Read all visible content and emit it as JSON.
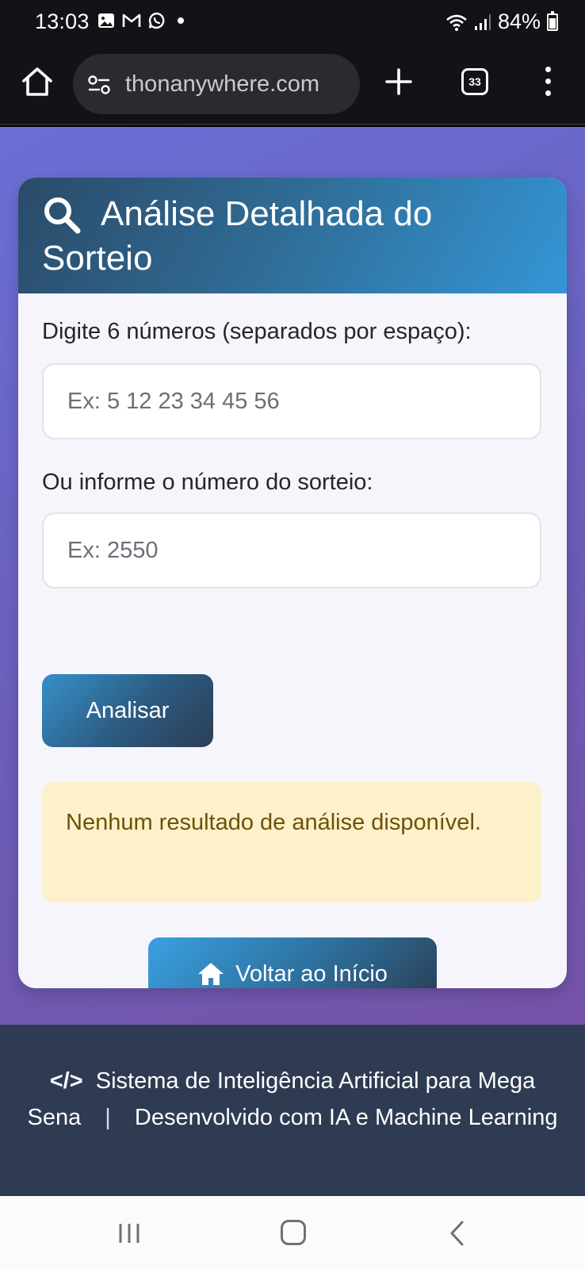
{
  "status_bar": {
    "time": "13:03",
    "battery": "84%",
    "notification_icons": [
      "gallery-icon",
      "gmail-icon",
      "whatsapp-icon"
    ]
  },
  "browser": {
    "url": "thonanywhere.com",
    "tab_count": "33"
  },
  "card": {
    "title": "Análise Detalhada do Sorteio",
    "numbers_label": "Digite 6 números (separados por espaço):",
    "numbers_placeholder": "Ex: 5 12 23 34 45 56",
    "draw_label": "Ou informe o número do sorteio:",
    "draw_placeholder": "Ex: 2550",
    "analyze_button": "Analisar",
    "alert_message": "Nenhum resultado de análise disponível.",
    "home_button": "Voltar ao Início"
  },
  "footer": {
    "text_part1": "Sistema de Inteligência Artificial para Mega Sena",
    "separator": "|",
    "text_part2": "Desenvolvido com IA e Machine Learning"
  },
  "colors": {
    "page_gradient_start": "#6a6fd6",
    "page_gradient_end": "#7553a8",
    "header_blue": "#3496d6",
    "alert_bg": "#fdf1cc",
    "alert_text": "#6d5206",
    "footer_bg": "#2f3b52"
  }
}
